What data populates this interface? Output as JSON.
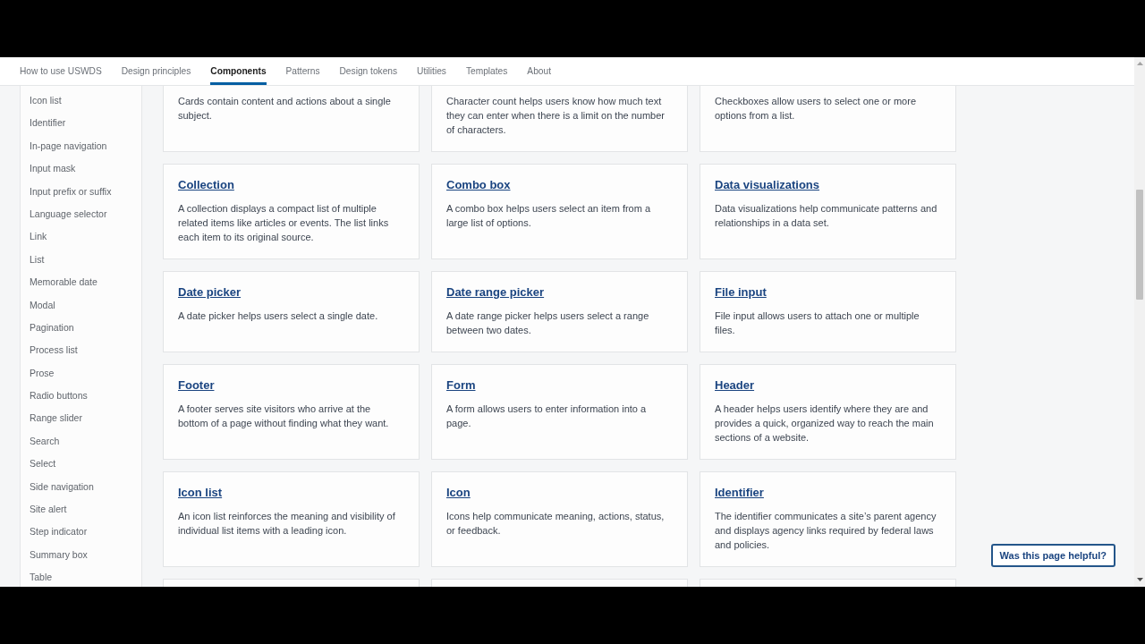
{
  "nav": {
    "items": [
      {
        "label": "How to use USWDS",
        "selected": false
      },
      {
        "label": "Design principles",
        "selected": false
      },
      {
        "label": "Components",
        "selected": true
      },
      {
        "label": "Patterns",
        "selected": false
      },
      {
        "label": "Design tokens",
        "selected": false
      },
      {
        "label": "Utilities",
        "selected": false
      },
      {
        "label": "Templates",
        "selected": false
      },
      {
        "label": "About",
        "selected": false
      }
    ]
  },
  "sidebar": {
    "items": [
      "Icon list",
      "Identifier",
      "In-page navigation",
      "Input mask",
      "Input prefix or suffix",
      "Language selector",
      "Link",
      "List",
      "Memorable date",
      "Modal",
      "Pagination",
      "Process list",
      "Prose",
      "Radio buttons",
      "Range slider",
      "Search",
      "Select",
      "Side navigation",
      "Site alert",
      "Step indicator",
      "Summary box",
      "Table"
    ]
  },
  "main": {
    "cards": [
      {
        "kind": "cut_top",
        "description": "Cards contain content and actions about a single subject."
      },
      {
        "kind": "cut_top",
        "description": "Character count helps users know how much text they can enter when there is a limit on the number of characters."
      },
      {
        "kind": "cut_top",
        "description": "Checkboxes allow users to select one or more options from a list."
      },
      {
        "kind": "full",
        "title": "Collection",
        "description": "A collection displays a compact list of multiple related items like articles or events. The list links each item to its original source."
      },
      {
        "kind": "full",
        "title": "Combo box",
        "description": "A combo box helps users select an item from a large list of options."
      },
      {
        "kind": "full",
        "title": "Data visualizations",
        "description": "Data visualizations help communicate patterns and relationships in a data set."
      },
      {
        "kind": "full",
        "title": "Date picker",
        "description": "A date picker helps users select a single date."
      },
      {
        "kind": "full",
        "title": "Date range picker",
        "description": "A date range picker helps users select a range between two dates."
      },
      {
        "kind": "full",
        "title": "File input",
        "description": "File input allows users to attach one or multiple files."
      },
      {
        "kind": "full",
        "title": "Footer",
        "description": "A footer serves site visitors who arrive at the bottom of a page without finding what they want."
      },
      {
        "kind": "full",
        "title": "Form",
        "description": "A form allows users to enter information into a page."
      },
      {
        "kind": "full",
        "title": "Header",
        "description": "A header helps users identify where they are and provides a quick, organized way to reach the main sections of a website."
      },
      {
        "kind": "full",
        "title": "Icon list",
        "description": "An icon list reinforces the meaning and visibility of individual list items with a leading icon."
      },
      {
        "kind": "full",
        "title": "Icon",
        "description": "Icons help communicate meaning, actions, status, or feedback."
      },
      {
        "kind": "full",
        "title": "Identifier",
        "description": "The identifier communicates a site’s parent agency and displays agency links required by federal laws and policies."
      },
      {
        "kind": "cut_bottom"
      },
      {
        "kind": "cut_bottom"
      },
      {
        "kind": "cut_bottom"
      }
    ]
  },
  "feedback_button": {
    "label": "Was this page helpful?"
  }
}
